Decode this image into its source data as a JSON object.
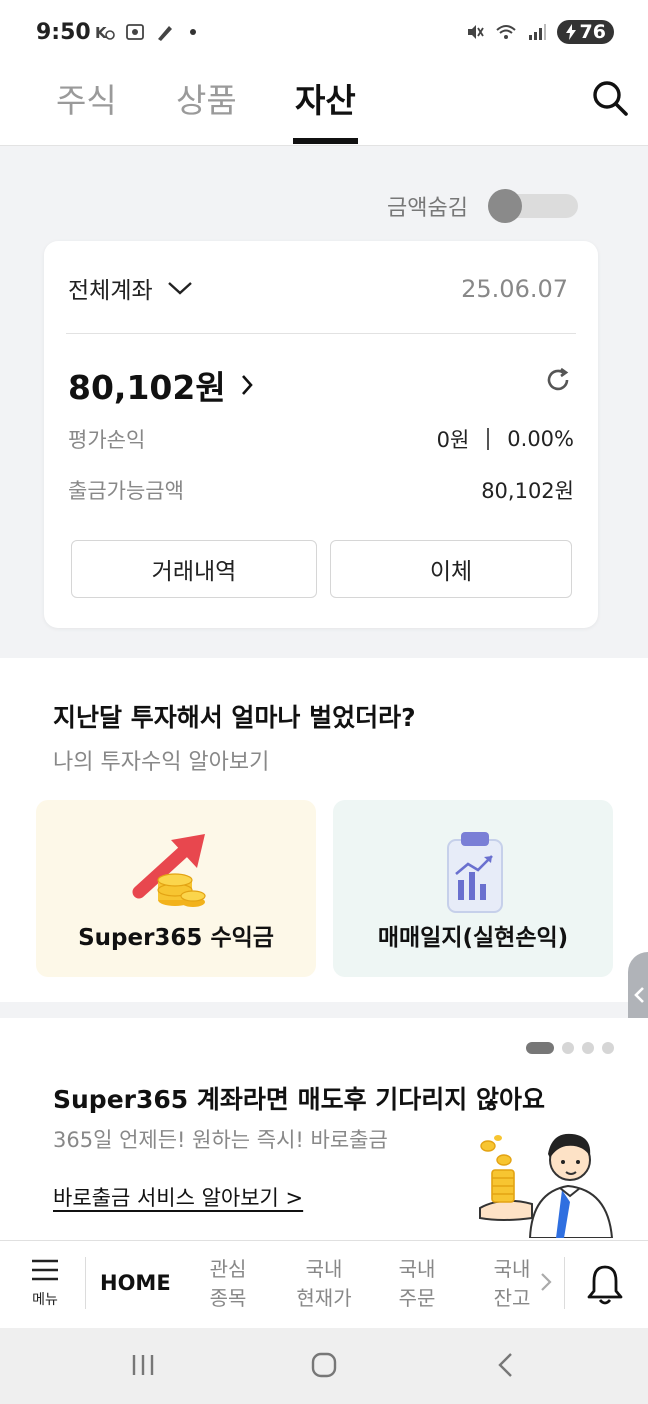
{
  "status": {
    "time": "9:50",
    "battery": "76"
  },
  "tabs": [
    {
      "label": "주식"
    },
    {
      "label": "상품"
    },
    {
      "label": "자산"
    }
  ],
  "hide_amount": {
    "label": "금액숨김",
    "on": false
  },
  "account": {
    "selector": "전체계좌",
    "date": "25.06.07",
    "total": "80,102원",
    "pl_label": "평가손익",
    "pl_amount": "0원",
    "pl_rate": "0.00%",
    "withdrawable_label": "출금가능금액",
    "withdrawable_amount": "80,102원",
    "history_button": "거래내역",
    "transfer_button": "이체"
  },
  "invest": {
    "title": "지난달 투자해서 얼마나 벌었더라?",
    "subtitle": "나의 투자수익 알아보기",
    "tiles": [
      {
        "label": "Super365 수익금",
        "bg": "#fdf8e8"
      },
      {
        "label": "매매일지(실현손익)",
        "bg": "#eef6f4"
      }
    ]
  },
  "promo": {
    "title": "Super365 계좌라면 매도후 기다리지 않아요",
    "subtitle": "365일 언제든! 원하는 즉시! 바로출금",
    "link": "바로출금 서비스 알아보기 >",
    "page_count": 4,
    "active_page": 1
  },
  "bottom_nav": {
    "menu_label": "메뉴",
    "home": "HOME",
    "items": [
      {
        "line1": "관심",
        "line2": "종목"
      },
      {
        "line1": "국내",
        "line2": "현재가"
      },
      {
        "line1": "국내",
        "line2": "주문"
      },
      {
        "line1": "국내",
        "line2": "잔고"
      }
    ]
  },
  "colors": {
    "accent_dark": "#111111",
    "muted": "#888888",
    "tile_yellow": "#fdf8e8",
    "tile_mint": "#eef6f4"
  }
}
